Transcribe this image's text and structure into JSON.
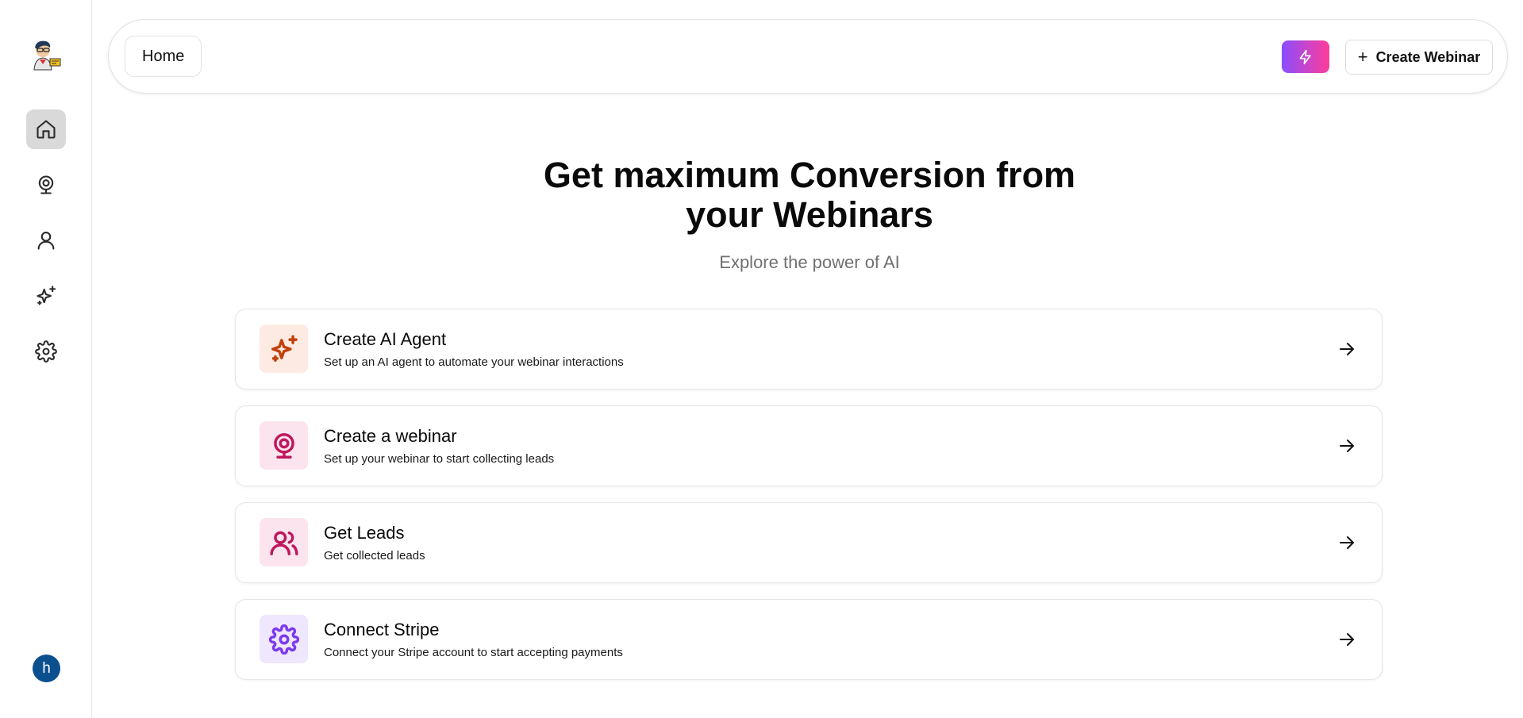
{
  "sidebar": {
    "items": [
      {
        "name": "home-icon",
        "active": true
      },
      {
        "name": "webinar-icon",
        "active": false
      },
      {
        "name": "user-icon",
        "active": false
      },
      {
        "name": "sparkles-icon",
        "active": false
      },
      {
        "name": "gear-icon",
        "active": false
      }
    ],
    "avatar_initial": "h"
  },
  "header": {
    "breadcrumb": "Home",
    "create_label": "Create Webinar",
    "create_icon": "+"
  },
  "hero": {
    "title_line1": "Get maximum Conversion from",
    "title_line2": "your Webinars",
    "subtitle": "Explore the power of AI"
  },
  "cards": [
    {
      "title": "Create AI Agent",
      "description": "Set up an AI agent to automate your webinar interactions",
      "icon": "sparkles-icon",
      "color": "#c2410c",
      "bg": "#fdeae3"
    },
    {
      "title": "Create a webinar",
      "description": "Set up your webinar to start collecting leads",
      "icon": "webcam-icon",
      "color": "#be185d",
      "bg": "#fce4ee"
    },
    {
      "title": "Get Leads",
      "description": "Get collected leads",
      "icon": "users-icon",
      "color": "#be185d",
      "bg": "#fce4ee"
    },
    {
      "title": "Connect Stripe",
      "description": "Connect your Stripe account to start accepting payments",
      "icon": "gear-icon",
      "color": "#7c3aed",
      "bg": "#efe7fd"
    }
  ],
  "colors": {
    "accent_gradient_start": "#8b4dff",
    "accent_gradient_end": "#ff3d9a",
    "avatar_bg": "#0b4f8f"
  }
}
